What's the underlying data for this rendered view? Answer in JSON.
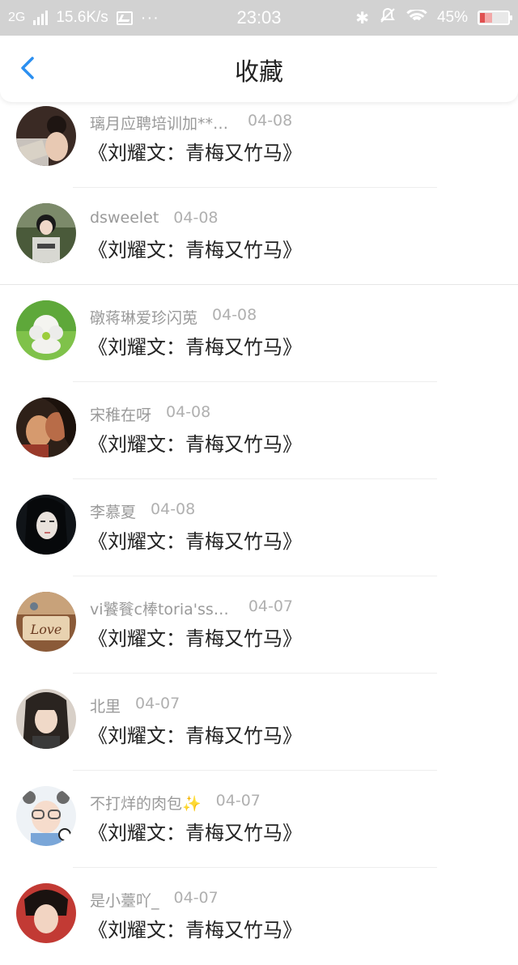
{
  "status_bar": {
    "network": "2G",
    "speed": "15.6K/s",
    "dots": "···",
    "time": "23:03",
    "battery": "45%",
    "battery_level": 0.45,
    "icons": [
      "signal-icon",
      "image-notification-icon",
      "bluetooth-icon",
      "mute-icon",
      "wifi-icon",
      "battery-icon"
    ]
  },
  "header": {
    "title": "收藏",
    "back_icon": "chevron-left-icon"
  },
  "accent_color": "#2b8ff0",
  "items": [
    {
      "name": "璃月应聘培训加**…",
      "date": "04-08",
      "content": "《刘耀文：青梅又竹马》"
    },
    {
      "name": "dsweelet",
      "date": "04-08",
      "content": "《刘耀文：青梅又竹马》"
    },
    {
      "name": "礅蒋琳爱珍闪莵",
      "date": "04-08",
      "content": "《刘耀文：青梅又竹马》"
    },
    {
      "name": "宋稚在呀",
      "date": "04-08",
      "content": "《刘耀文：青梅又竹马》"
    },
    {
      "name": "李慕夏",
      "date": "04-08",
      "content": "《刘耀文：青梅又竹马》"
    },
    {
      "name": "vi饕餮c棒toria'ss…",
      "date": "04-07",
      "content": "《刘耀文：青梅又竹马》"
    },
    {
      "name": "北里",
      "date": "04-07",
      "content": "《刘耀文：青梅又竹马》"
    },
    {
      "name": "不打烊的肉包✨",
      "date": "04-07",
      "content": "《刘耀文：青梅又竹马》"
    },
    {
      "name": "是小薹吖_",
      "date": "04-07",
      "content": "《刘耀文：青梅又竹马》"
    }
  ]
}
